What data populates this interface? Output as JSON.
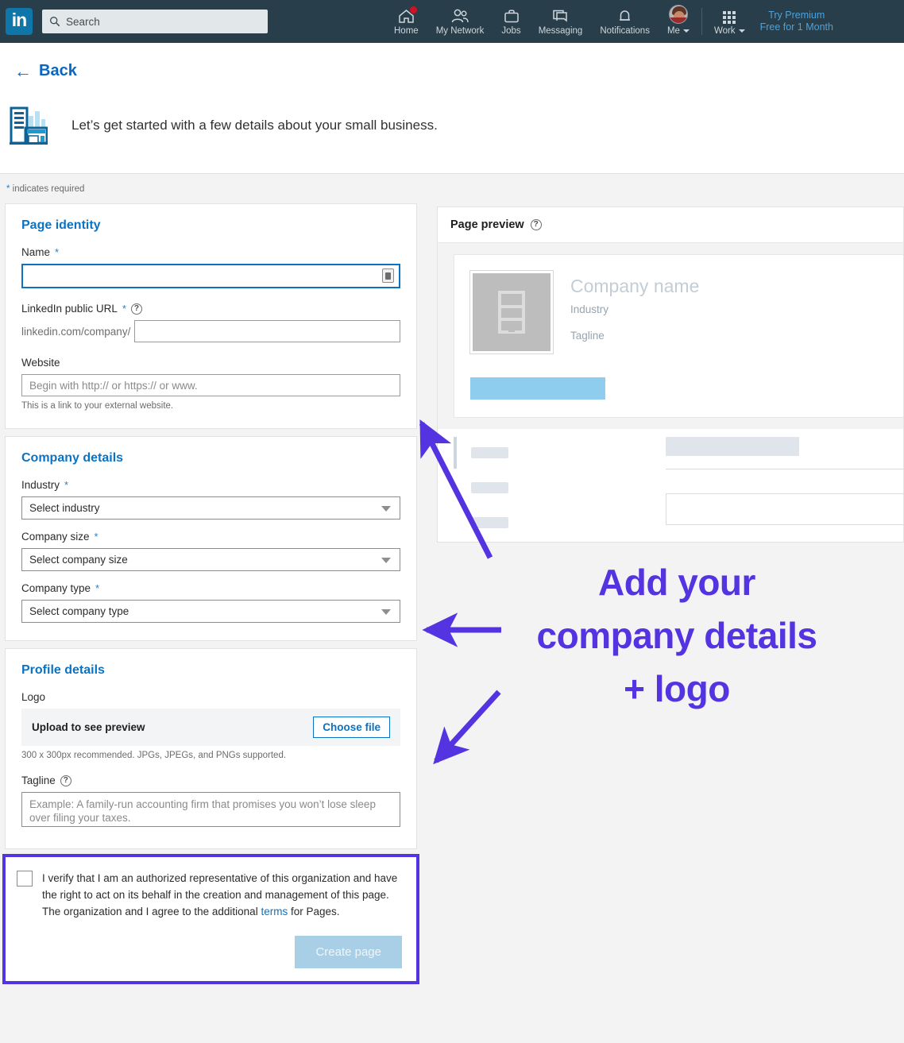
{
  "nav": {
    "logo_text": "in",
    "search_placeholder": "Search",
    "items": [
      {
        "label": "Home",
        "icon": "home-icon",
        "badge": true
      },
      {
        "label": "My Network",
        "icon": "people-icon",
        "badge": false
      },
      {
        "label": "Jobs",
        "icon": "briefcase-icon",
        "badge": false
      },
      {
        "label": "Messaging",
        "icon": "message-icon",
        "badge": false
      },
      {
        "label": "Notifications",
        "icon": "bell-icon",
        "badge": false
      },
      {
        "label": "Me",
        "icon": "avatar-icon",
        "badge": false
      }
    ],
    "work_label": "Work",
    "premium_line1": "Try Premium",
    "premium_line2": "Free for 1 Month"
  },
  "header": {
    "back_label": "Back",
    "back_arrow": "←",
    "intro": "Let’s get started with a few details about your small business.",
    "business_icon": "small-business-icon"
  },
  "required_note": {
    "star": "*",
    "text": " indicates required"
  },
  "page_identity": {
    "title": "Page identity",
    "name_label": "Name",
    "name_value": "",
    "name_required": "*",
    "url_label": "LinkedIn public URL",
    "url_required": "*",
    "url_prefix": "linkedin.com/company/",
    "url_value": "",
    "website_label": "Website",
    "website_placeholder": "Begin with http:// or https:// or www.",
    "website_value": "",
    "website_help": "This is a link to your external website."
  },
  "company_details": {
    "title": "Company details",
    "industry_label": "Industry",
    "industry_required": "*",
    "industry_value": "Select industry",
    "size_label": "Company size",
    "size_required": "*",
    "size_value": "Select company size",
    "type_label": "Company type",
    "type_required": "*",
    "type_value": "Select company type"
  },
  "profile_details": {
    "title": "Profile details",
    "logo_label": "Logo",
    "upload_text": "Upload to see preview",
    "choose_file_label": "Choose file",
    "logo_help": "300 x 300px recommended. JPGs, JPEGs, and PNGs supported.",
    "tagline_label": "Tagline",
    "tagline_placeholder": "Example: A family-run accounting firm that promises you won’t lose sleep over filing your taxes.",
    "tagline_value": ""
  },
  "verification": {
    "text_part1": "I verify that I am an authorized representative of this organization and have the right to act on its behalf in the creation and management of this page. The organization and I agree to the additional ",
    "terms_link": "terms",
    "text_part2": " for Pages.",
    "checked": false,
    "create_button": "Create page",
    "create_enabled": false
  },
  "preview": {
    "title": "Page preview",
    "company_name": "Company name",
    "industry": "Industry",
    "tagline": "Tagline"
  },
  "annotation": {
    "line1": "Add your",
    "line2": "company details",
    "line3": "+ logo",
    "color": "#5433e0"
  },
  "colors": {
    "nav_background": "#283e4a",
    "linkedin_blue": "#0a73c4",
    "annotation_purple": "#5433e0",
    "page_background": "#f3f3f3",
    "badge_red": "#d11124"
  }
}
